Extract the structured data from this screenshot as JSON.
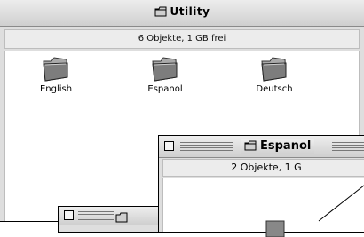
{
  "utility_window": {
    "title": "Utility",
    "info": "6 Objekte, 1 GB frei",
    "items": [
      {
        "label": "English",
        "icon": "folder-icon"
      },
      {
        "label": "Espanol",
        "icon": "folder-icon"
      },
      {
        "label": "Deutsch",
        "icon": "folder-icon"
      }
    ]
  },
  "espanol_window": {
    "title": "Espanol",
    "info": "2 Objekte, 1 G"
  },
  "colors": {
    "titlebar_top": "#eeeeee",
    "titlebar_bottom": "#cfcfcf",
    "window_bg": "#dedede",
    "content_bg": "#ffffff"
  }
}
